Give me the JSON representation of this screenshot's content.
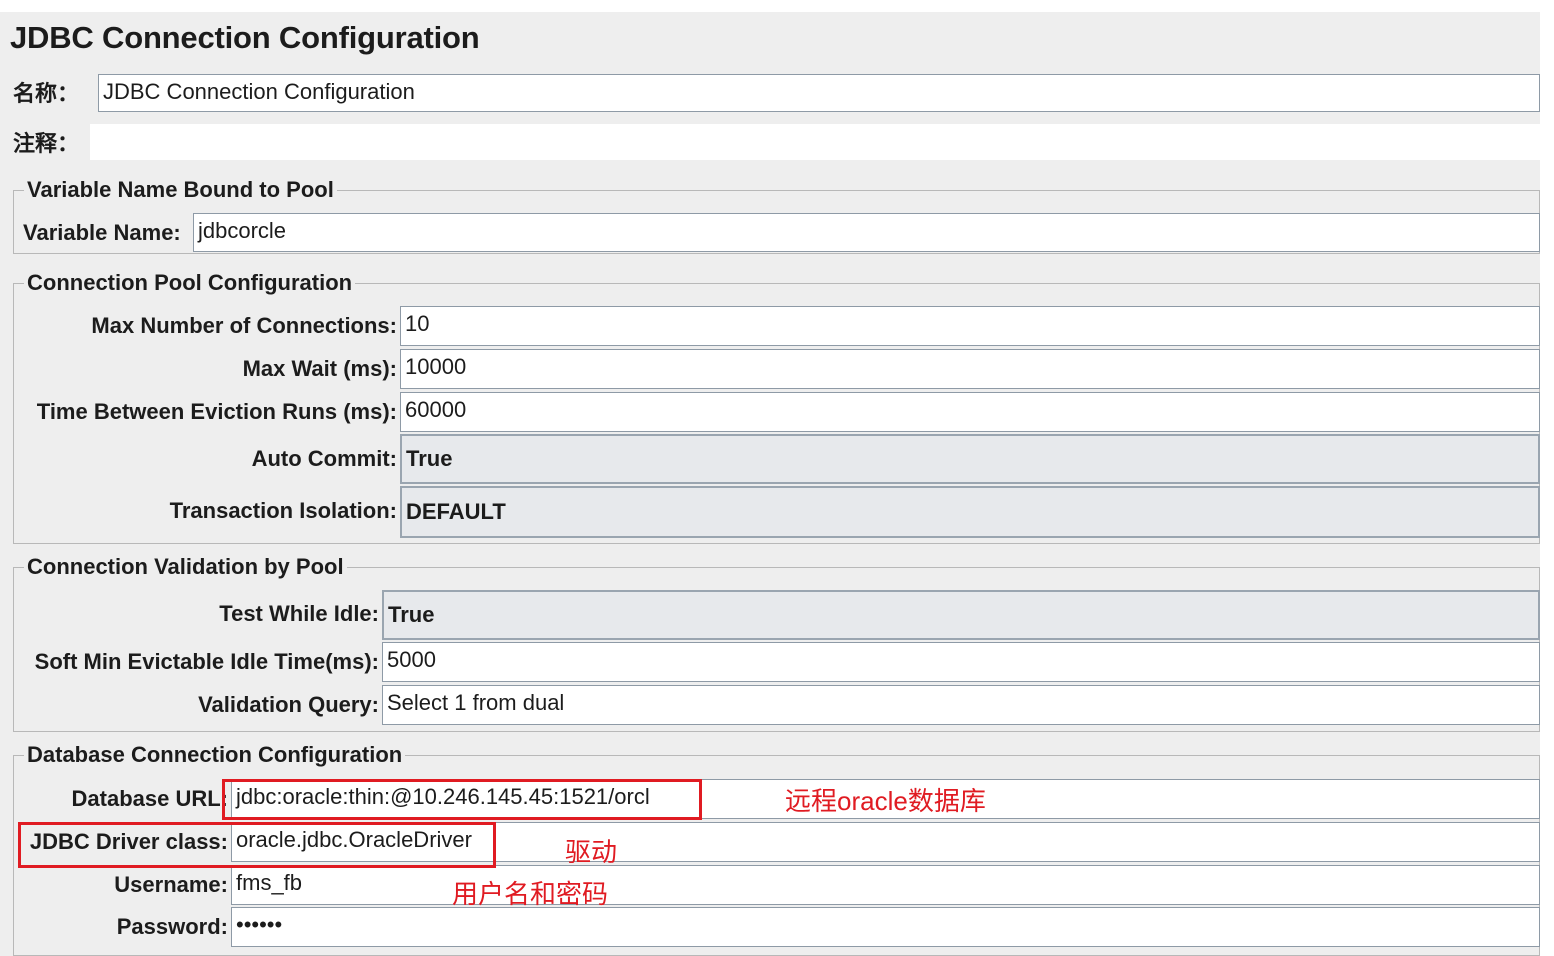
{
  "header": {
    "title": "JDBC Connection Configuration"
  },
  "name_row": {
    "label": "名称：",
    "value": "JDBC Connection Configuration"
  },
  "comment_row": {
    "label": "注释：",
    "value": ""
  },
  "variable_section": {
    "legend": "Variable Name Bound to Pool",
    "variable_name_label": "Variable Name:",
    "variable_name_value": "jdbcorcle"
  },
  "pool_section": {
    "legend": "Connection Pool Configuration",
    "max_connections_label": "Max Number of Connections:",
    "max_connections_value": "10",
    "max_wait_label": "Max Wait (ms):",
    "max_wait_value": "10000",
    "eviction_label": "Time Between Eviction Runs (ms):",
    "eviction_value": "60000",
    "auto_commit_label": "Auto Commit:",
    "auto_commit_value": "True",
    "isolation_label": "Transaction Isolation:",
    "isolation_value": "DEFAULT"
  },
  "validation_section": {
    "legend": "Connection Validation by Pool",
    "test_idle_label": "Test While Idle:",
    "test_idle_value": "True",
    "soft_min_label": "Soft Min Evictable Idle Time(ms):",
    "soft_min_value": "5000",
    "query_label": "Validation Query:",
    "query_value": "Select 1 from dual"
  },
  "db_section": {
    "legend": "Database Connection Configuration",
    "url_label": "Database URL:",
    "url_value": "jdbc:oracle:thin:@10.246.145.45:1521/orcl",
    "driver_label": "JDBC Driver class:",
    "driver_value": "oracle.jdbc.OracleDriver",
    "username_label": "Username:",
    "username_value": "fms_fb",
    "password_label": "Password:",
    "password_value": "••••••"
  },
  "annotations": {
    "url_note": "远程oracle数据库",
    "driver_note": "驱动",
    "credentials_note": "用户名和密码",
    "highlight_color": "#e01b22"
  }
}
